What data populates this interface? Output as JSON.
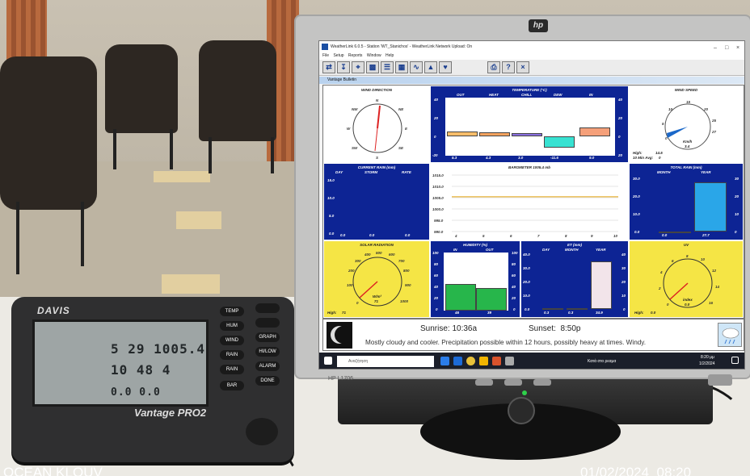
{
  "console": {
    "brand": "DAVIS",
    "model": "Vantage PRO2",
    "lcd_row1": "5 29 1005.4",
    "lcd_row2": "10 48 4",
    "lcd_row3": "0.0 0.0",
    "keys_left": [
      "TEMP",
      "HUM",
      "WIND",
      "RAIN",
      "RAIN",
      "BAR"
    ],
    "keys_right": [
      "",
      "",
      "GRAPH",
      "HI/LOW",
      "ALARM",
      "DONE"
    ]
  },
  "app": {
    "title": "WeatherLink 6.0.5 - Station 'WT_Stanichos' - WeatherLink Network Upload: On",
    "menu": [
      "File",
      "Setup",
      "Reports",
      "Window",
      "Help"
    ],
    "child_title": "Vantage Bulletin"
  },
  "panels": {
    "wind_direction": {
      "title": "WIND DIRECTION",
      "compass": [
        "N",
        "NE",
        "E",
        "SE",
        "S",
        "SW",
        "W",
        "NW"
      ]
    },
    "temperature": {
      "title": "TEMPERATURE (°C)",
      "headers": [
        "OUT",
        "HEAT",
        "CHILL",
        "DEW",
        "IN"
      ],
      "ticks": [
        "40",
        "20",
        "0",
        "-20"
      ],
      "right_ticks": [
        "40",
        "20",
        "0",
        "20"
      ],
      "values": [
        "5.3",
        "4.3",
        "3.0",
        "-11.6",
        "9.0"
      ]
    },
    "wind_speed": {
      "title": "WIND SPEED",
      "unit": "Km/h",
      "value": "3.4",
      "high_label": "High:",
      "high_value": "14.5",
      "avg_label": "10 Min Avg:",
      "avg_value": "0",
      "dial": [
        "0",
        "5",
        "10",
        "15",
        "20",
        "25",
        "27"
      ]
    },
    "current_rain": {
      "title": "CURRENT RAIN (mm)",
      "headers": [
        "DAY",
        "STORM",
        "RATE"
      ],
      "ticks": [
        "15.0",
        "10.0",
        "5.0",
        "0.0"
      ],
      "values": [
        "0.0",
        "0.0",
        "0.0"
      ]
    },
    "barometer": {
      "title": "BAROMETER 1005.4 mb",
      "ticks": [
        "1015.0",
        "1010.0",
        "1005.0",
        "1000.0",
        "995.0",
        "990.0"
      ],
      "x_ticks": [
        "4",
        "5",
        "6",
        "7",
        "8",
        "9",
        "10"
      ]
    },
    "total_rain": {
      "title": "TOTAL RAIN (mm)",
      "headers": [
        "MONTH",
        "YEAR"
      ],
      "ticks": [
        "30.0",
        "20.0",
        "10.0",
        "0.0"
      ],
      "right_ticks": [
        "30",
        "20",
        "10",
        "0"
      ],
      "values": [
        "0.0",
        "27.7"
      ]
    },
    "solar": {
      "title": "SOLAR RADIATION",
      "unit": "W/m²",
      "value": "71",
      "high_label": "High:",
      "high_value": "71",
      "dial": [
        "0",
        "100",
        "200",
        "300",
        "400",
        "500",
        "600",
        "700",
        "800",
        "900",
        "1000"
      ]
    },
    "humidity": {
      "title": "HUMIDITY (%)",
      "headers": [
        "IN",
        "OUT"
      ],
      "ticks": [
        "100",
        "80",
        "60",
        "40",
        "20",
        "0"
      ],
      "values": [
        "46",
        "39"
      ]
    },
    "et": {
      "title": "ET (mm)",
      "headers": [
        "DAY",
        "MONTH",
        "YEAR"
      ],
      "ticks": [
        "40.0",
        "30.0",
        "20.0",
        "10.0",
        "0.0"
      ],
      "right_ticks": [
        "40",
        "30",
        "20",
        "10",
        "0"
      ],
      "values": [
        "0.3",
        "0.3",
        "34.9"
      ]
    },
    "uv": {
      "title": "UV",
      "unit": "index",
      "value": "0.0",
      "high_label": "High:",
      "high_value": "0.0",
      "dial": [
        "0",
        "2",
        "4",
        "6",
        "8",
        "10",
        "12",
        "14",
        "16"
      ]
    }
  },
  "sun": {
    "sunrise": "Sunrise: 10:36a",
    "sunset": "Sunset:  8:50p",
    "forecast": "Mostly cloudy and cooler.  Precipitation possible within 12 hours, possibly heavy at times.  Windy."
  },
  "taskbar": {
    "search_placeholder": "Αναζήτηση",
    "weather_tray": "Κατά στο ρεαμα",
    "clock": "8:20 μμ",
    "date": "1/2/2024"
  },
  "monitor": {
    "brand": "hp",
    "model": "HP L1706"
  },
  "photo": {
    "location_stamp": "OCEAN KLOUV",
    "date_stamp": "01/02/2024  08:20"
  },
  "colors": {
    "panel_blue": "#0d2494",
    "panel_yellow": "#f5e545",
    "temp_out": "#f7bd6a",
    "temp_heat": "#f6a35e",
    "temp_chill": "#8a6fe0",
    "temp_dew": "#38e2d2",
    "temp_in": "#f5a07a",
    "rain_year": "#2aa6e8",
    "humidity": "#27b64b"
  },
  "chart_data": [
    {
      "type": "bar",
      "title": "TEMPERATURE (°C)",
      "categories": [
        "OUT",
        "HEAT",
        "CHILL",
        "DEW",
        "IN"
      ],
      "values": [
        5.3,
        4.3,
        3.0,
        -11.6,
        9.0
      ],
      "ylim": [
        -20,
        40
      ]
    },
    {
      "type": "bar",
      "title": "HUMIDITY (%)",
      "categories": [
        "IN",
        "OUT"
      ],
      "values": [
        46,
        39
      ],
      "ylim": [
        0,
        100
      ]
    },
    {
      "type": "bar",
      "title": "TOTAL RAIN (mm)",
      "categories": [
        "MONTH",
        "YEAR"
      ],
      "values": [
        0.0,
        27.7
      ],
      "ylim": [
        0,
        30
      ]
    },
    {
      "type": "bar",
      "title": "ET (mm)",
      "categories": [
        "DAY",
        "MONTH",
        "YEAR"
      ],
      "values": [
        0.3,
        0.3,
        34.9
      ],
      "ylim": [
        0,
        40
      ]
    },
    {
      "type": "line",
      "title": "BAROMETER 1005.4 mb",
      "x": [
        4,
        5,
        6,
        7,
        8,
        9,
        10
      ],
      "values": [
        1005.4,
        1005.4,
        1005.4,
        1005.4,
        1005.4,
        1005.4,
        1005.4
      ],
      "ylim": [
        990,
        1015
      ]
    }
  ]
}
